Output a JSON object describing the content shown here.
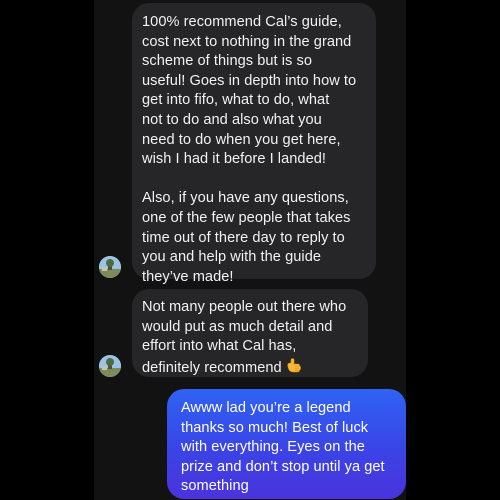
{
  "messages": [
    {
      "sender": "other",
      "lines": [
        "100% recommend Cal’s guide,",
        "cost next to nothing in the grand",
        "scheme of things but is so",
        "useful! Goes in depth into how to",
        "get into fifo, what to do, what",
        "not to do and also what you",
        "need to do when you get here,",
        "wish I had it before I landed!",
        "",
        "Also, if you have any questions,",
        "one of the few people that takes",
        "time out of there day to reply to",
        "you and help with the guide",
        "they’ve made!"
      ]
    },
    {
      "sender": "other",
      "lines": [
        "Not many people out there who",
        "would put as much detail and",
        "effort into what Cal has,",
        "definitely recommend"
      ],
      "emoji": "🤙"
    },
    {
      "sender": "me",
      "lines": [
        "Awww lad you’re a legend",
        "thanks so much! Best of luck",
        "with everything. Eyes on the",
        "prize and don’t stop until ya get",
        "something"
      ]
    }
  ],
  "colors": {
    "background": "#000000",
    "chat_background": "#121212",
    "incoming_bubble": "#262628",
    "outgoing_bubble_top": "#2f63f3",
    "outgoing_bubble_bottom": "#4a33dc"
  },
  "icons": {
    "avatar": "profile-photo",
    "emoji": "call-me-hand-emoji"
  }
}
